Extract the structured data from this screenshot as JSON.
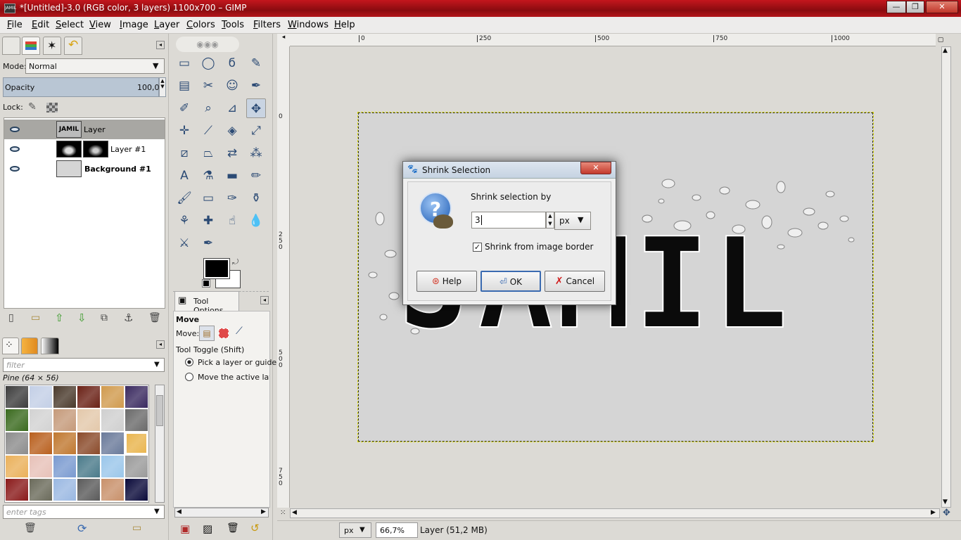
{
  "window": {
    "title": "*[Untitled]-3.0 (RGB color, 3 layers) 1100x700 – GIMP",
    "icon_text": "JAMIL",
    "controls": {
      "minimize": "—",
      "maximize": "❐",
      "close": "✕"
    }
  },
  "menubar": [
    "File",
    "Edit",
    "Select",
    "View",
    "Image",
    "Layer",
    "Colors",
    "Tools",
    "Filters",
    "Windows",
    "Help"
  ],
  "layers_panel": {
    "mode_label": "Mode:",
    "mode_value": "Normal",
    "opacity_label": "Opacity",
    "opacity_value": "100,0",
    "lock_label": "Lock:",
    "layers": [
      {
        "name": "Layer",
        "thumb_text": "JAMIL",
        "selected": true,
        "bold": false
      },
      {
        "name": "Layer #1",
        "selected": false,
        "bold": false
      },
      {
        "name": "Background #1",
        "selected": false,
        "bold": true
      }
    ]
  },
  "patterns_panel": {
    "filter_placeholder": "filter",
    "selected_pattern": "Pine (64 × 56)",
    "tags_placeholder": "enter tags",
    "swatch_colors": [
      "#3d3d3d",
      "#c3cfe6",
      "#4a3a2c",
      "#6a2116",
      "#d09a4d",
      "#3a2a60",
      "#3a6a1e",
      "#d2d2d2",
      "#c59a7a",
      "#e3c8aa",
      "#cfcfcf",
      "#6a6a6a",
      "#8c8c8c",
      "#b9601e",
      "#c07830",
      "#8a4a2a",
      "#6a7a9a",
      "#e9b44c",
      "#eab05a",
      "#e7c1b8",
      "#7a9ad0",
      "#4a7a8a",
      "#9ac6ea",
      "#9a9a9a",
      "#8a1a1a",
      "#6a6a5a",
      "#9ab8e2",
      "#5a5a5a",
      "#c8906a",
      "#0a0a3a"
    ]
  },
  "toolbox": {
    "tools": [
      "▭",
      "◯",
      "ϭ",
      "✎",
      "▤",
      "✂",
      "☺",
      "✒",
      "✐",
      "⌕",
      "⊿",
      "✥",
      "✛",
      "⟋",
      "◈",
      "⤢",
      "⧄",
      "⏢",
      "⇄",
      "⁂",
      "A",
      "⚗",
      "▬",
      "✏",
      "🖌",
      "▭",
      "✑",
      "⚱",
      "⚘",
      "✚",
      "☝",
      "💧",
      "⚔",
      "✒"
    ],
    "fg_color": "#000000",
    "bg_color": "#ffffff",
    "options_tab": "Tool Options",
    "options_title": "Move",
    "move_label": "Move:",
    "toggle_label": "Tool Toggle  (Shift)",
    "radio_1": "Pick a layer or guide",
    "radio_2": "Move the active layer"
  },
  "canvas": {
    "ruler_h": [
      "0",
      "250",
      "500",
      "750",
      "1000"
    ],
    "ruler_v": [
      "0",
      "250",
      "500",
      "750"
    ],
    "image_text": "JAMIL",
    "status_unit": "px",
    "zoom": "66,7%",
    "status_text": "Layer (51,2 MB)"
  },
  "dialog": {
    "title": "Shrink Selection",
    "prompt": "Shrink selection by",
    "amount": "3",
    "unit": "px",
    "checkbox_label": "Shrink from image border",
    "checkbox_checked": true,
    "help_label": "Help",
    "ok_label": "OK",
    "cancel_label": "Cancel",
    "close_symbol": "✕"
  }
}
